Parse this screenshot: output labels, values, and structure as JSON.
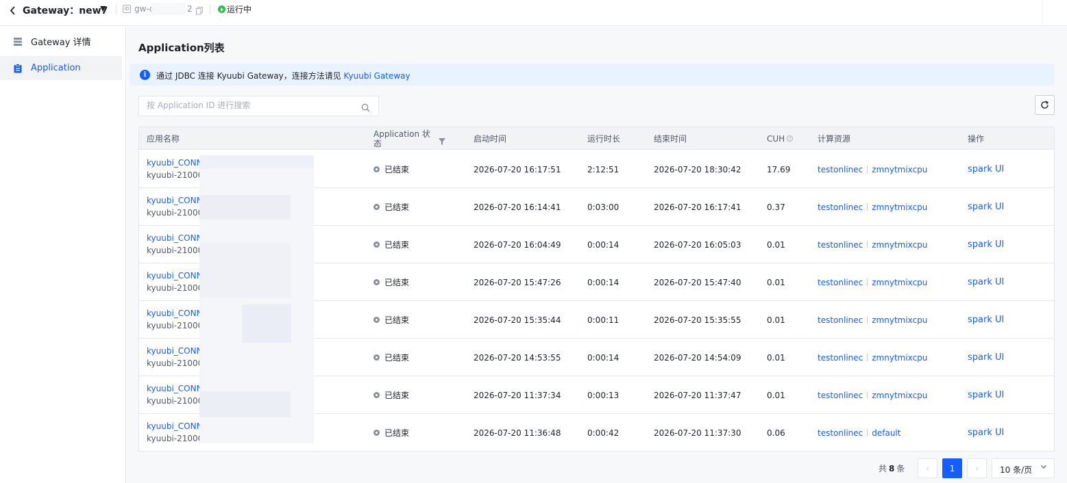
{
  "topbar": {
    "title": "Gateway：new7",
    "id_prefix": "gw-c",
    "id_suffix": "2",
    "status": "运行中"
  },
  "sidebar": {
    "items": [
      {
        "label": "Gateway 详情",
        "icon": "server-icon",
        "active": false
      },
      {
        "label": "Application",
        "icon": "clipboard-icon",
        "active": true
      }
    ]
  },
  "main": {
    "title": "Application列表",
    "info": {
      "text": "通过 JDBC 连接 Kyuubi Gateway，连接方法请见 ",
      "link": "Kyuubi Gateway"
    },
    "search": {
      "placeholder": "按 Application ID 进行搜索",
      "value": ""
    }
  },
  "table": {
    "columns": [
      "应用名称",
      "Application 状态",
      "启动时间",
      "运行时长",
      "结束时间",
      "CUH",
      "计算资源",
      "操作"
    ],
    "rows": [
      {
        "name": "kyuubi_CONN",
        "sub": "kyuubi-21000",
        "status": "已结束",
        "start": "2026-07-20 16:17:51",
        "duration": "2:12:51",
        "end": "2026-07-20 18:30:42",
        "cuh": "17.69",
        "res1": "testonlinec",
        "res2": "zmnytmixcpu",
        "op": "spark UI"
      },
      {
        "name": "kyuubi_CONN",
        "sub": "kyuubi-21000",
        "status": "已结束",
        "start": "2026-07-20 16:14:41",
        "duration": "0:03:00",
        "end": "2026-07-20 16:17:41",
        "cuh": "0.37",
        "res1": "testonlinec",
        "res2": "zmnytmixcpu",
        "op": "spark UI"
      },
      {
        "name": "kyuubi_CONN",
        "sub": "kyuubi-21000",
        "status": "已结束",
        "start": "2026-07-20 16:04:49",
        "duration": "0:00:14",
        "end": "2026-07-20 16:05:03",
        "cuh": "0.01",
        "res1": "testonlinec",
        "res2": "zmnytmixcpu",
        "op": "spark UI"
      },
      {
        "name": "kyuubi_CONN",
        "sub": "kyuubi-21000",
        "status": "已结束",
        "start": "2026-07-20 15:47:26",
        "duration": "0:00:14",
        "end": "2026-07-20 15:47:40",
        "cuh": "0.01",
        "res1": "testonlinec",
        "res2": "zmnytmixcpu",
        "op": "spark UI"
      },
      {
        "name": "kyuubi_CONN",
        "sub": "kyuubi-21000",
        "status": "已结束",
        "start": "2026-07-20 15:35:44",
        "duration": "0:00:11",
        "end": "2026-07-20 15:35:55",
        "cuh": "0.01",
        "res1": "testonlinec",
        "res2": "zmnytmixcpu",
        "op": "spark UI"
      },
      {
        "name": "kyuubi_CONN",
        "sub": "kyuubi-21000",
        "status": "已结束",
        "start": "2026-07-20 14:53:55",
        "duration": "0:00:14",
        "end": "2026-07-20 14:54:09",
        "cuh": "0.01",
        "res1": "testonlinec",
        "res2": "zmnytmixcpu",
        "op": "spark UI"
      },
      {
        "name": "kyuubi_CONN",
        "sub": "kyuubi-21000",
        "status": "已结束",
        "start": "2026-07-20 11:37:34",
        "duration": "0:00:13",
        "end": "2026-07-20 11:37:47",
        "cuh": "0.01",
        "res1": "testonlinec",
        "res2": "zmnytmixcpu",
        "op": "spark UI"
      },
      {
        "name": "kyuubi_CONN",
        "sub": "kyuubi-21000",
        "status": "已结束",
        "start": "2026-07-20 11:36:48",
        "duration": "0:00:42",
        "end": "2026-07-20 11:37:30",
        "cuh": "0.06",
        "res1": "testonlinec",
        "res2": "default",
        "op": "spark UI"
      }
    ]
  },
  "pagination": {
    "total_prefix": "共",
    "total": "8",
    "total_suffix": "条",
    "prev": "‹",
    "current": "1",
    "next": "›",
    "page_size": "10 条/页"
  },
  "colors": {
    "accent": "#165dff",
    "running": "#23c343",
    "ended": "#86909c"
  }
}
